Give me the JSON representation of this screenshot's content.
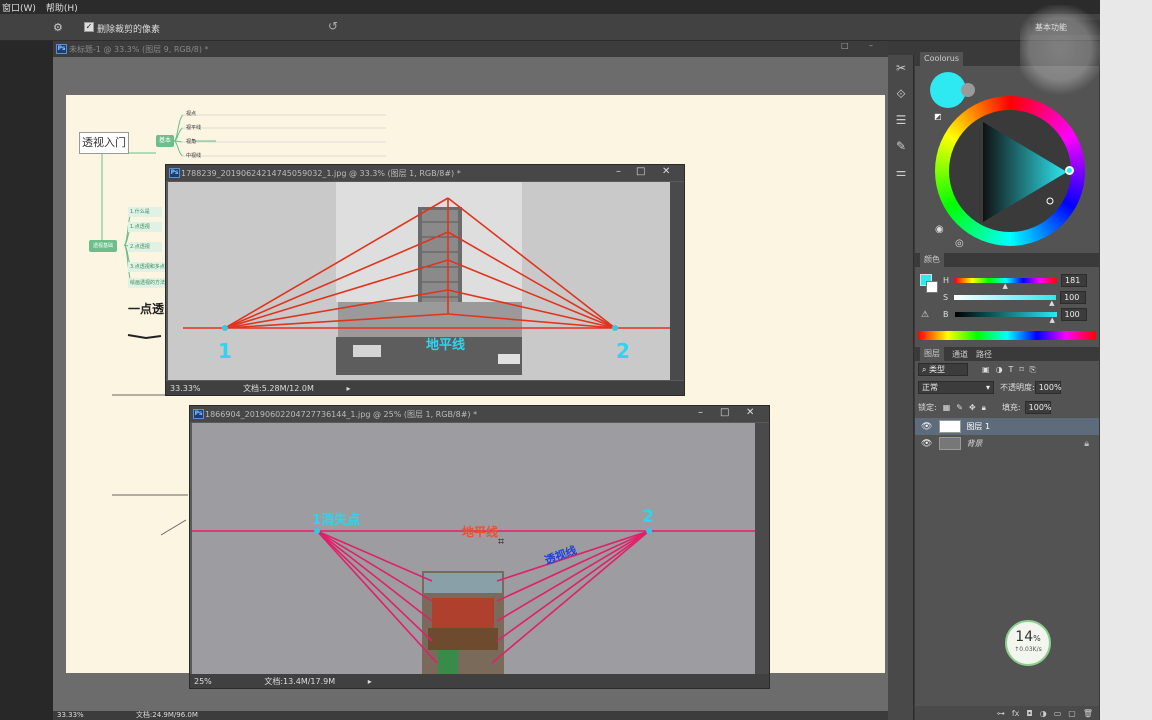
{
  "menubar": {
    "items": [
      "窗口(W)",
      "帮助(H)"
    ]
  },
  "options": {
    "checkbox_label": "删除裁剪的像素",
    "checked": true,
    "workspace": "基本功能"
  },
  "main_doc": {
    "tab_title": "未标题-1 @ 33.3% (图层 9, RGB/8) *",
    "zoom": "33.33%",
    "doc_info": "文档:24.9M/96.0M"
  },
  "mindmap": {
    "root": "透视入门",
    "branch_a": "基本",
    "branch_a_items": [
      "视点",
      "视平线",
      "视角",
      "中视线"
    ],
    "branch_b": "透视基础",
    "branch_b_items": [
      "1.什么是",
      "1.点透视",
      "2.点透视",
      "3.点透视和多点",
      "绘画透视的方法"
    ],
    "handwriting": "一点透"
  },
  "window1": {
    "title": "1788239_20190624214745059032_1.jpg @ 33.3% (图层 1, RGB/8#) *",
    "zoom": "33.33%",
    "doc_info": "文档:5.28M/12.0M",
    "label_1": "1",
    "label_2": "2",
    "label_horizon": "地平线"
  },
  "window2": {
    "title": "1866904_20190602204727736144_1.jpg @ 25% (图层 1, RGB/8#) *",
    "zoom": "25%",
    "doc_info": "文档:13.4M/17.9M",
    "label_1": "1消失点",
    "label_2": "2",
    "label_horizon": "地平线",
    "label_blue": "透视线"
  },
  "coolorus": {
    "title": "Coolorus",
    "fg_color": "#2ee8f2"
  },
  "color_panel": {
    "tabs": [
      "颜色"
    ],
    "h_label": "H",
    "s_label": "S",
    "b_label": "B",
    "h_value": "181",
    "s_value": "100",
    "b_value": "100",
    "h_level": 0.5,
    "s_level": 1.0,
    "b_level": 1.0
  },
  "layers": {
    "tabs": [
      "图层",
      "通道",
      "路径"
    ],
    "filter_kind": "类型",
    "blend_mode": "正常",
    "opacity_label": "不透明度:",
    "opacity_value": "100%",
    "lock_label": "锁定:",
    "fill_label": "填充:",
    "fill_value": "100%",
    "items": [
      {
        "name": "图层 1",
        "selected": true,
        "locked": false
      },
      {
        "name": "背景",
        "selected": false,
        "locked": true
      }
    ]
  },
  "net_monitor": {
    "percent": "14",
    "unit": "%",
    "speed": "↑0.03K/s"
  }
}
